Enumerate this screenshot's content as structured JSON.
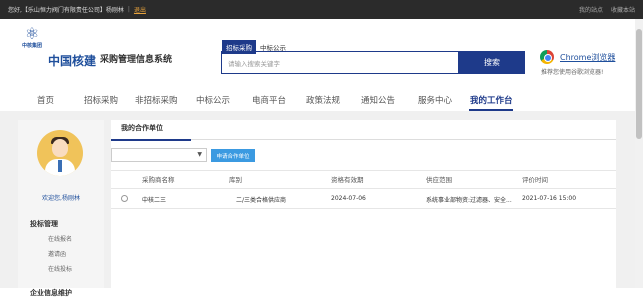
{
  "topbar": {
    "greeting": "您好,【乐山恒力阀门有限责任公司】杨刚林",
    "separator": "|",
    "logout": "退出",
    "links": [
      "我的站点",
      "收藏本站"
    ]
  },
  "header": {
    "logo_sub": "中核集团",
    "brand": "中国核建",
    "system_name": "采购管理信息系统",
    "search_tabs": [
      "招标采购",
      "中标公示"
    ],
    "search_placeholder": "请输入搜索关键字",
    "search_button": "搜索",
    "browser_link": "Chrome浏览器",
    "browser_tip": "推荐您使用谷歌浏览器!"
  },
  "nav": {
    "items": [
      "首页",
      "招标采购",
      "非招标采购",
      "中标公示",
      "电商平台",
      "政策法规",
      "通知公告",
      "服务中心",
      "我的工作台"
    ],
    "active": "我的工作台"
  },
  "sidebar": {
    "welcome": "欢迎您,杨刚林",
    "sections": [
      {
        "title": "投标管理",
        "items": [
          "在线报名",
          "邀请函",
          "在线投标"
        ]
      },
      {
        "title": "企业信息维护",
        "items": []
      }
    ]
  },
  "content": {
    "tab": "我的合作单位",
    "select_value": "",
    "apply_button": "申请合作单位",
    "columns": [
      "采购商名称",
      "库别",
      "资格有效期",
      "供应范围",
      "评价时间"
    ],
    "rows": [
      {
        "name": "中核二三",
        "category": "二/三类合格供应商",
        "valid_until": "2024-07-06",
        "scope": "系统事业部物资:过滤器、安全...",
        "eval_time": "2021-07-16 15:00"
      }
    ]
  },
  "colors": {
    "primary": "#1e3a8a",
    "topbar": "#2b2b2b",
    "apply": "#3b9ae1"
  }
}
